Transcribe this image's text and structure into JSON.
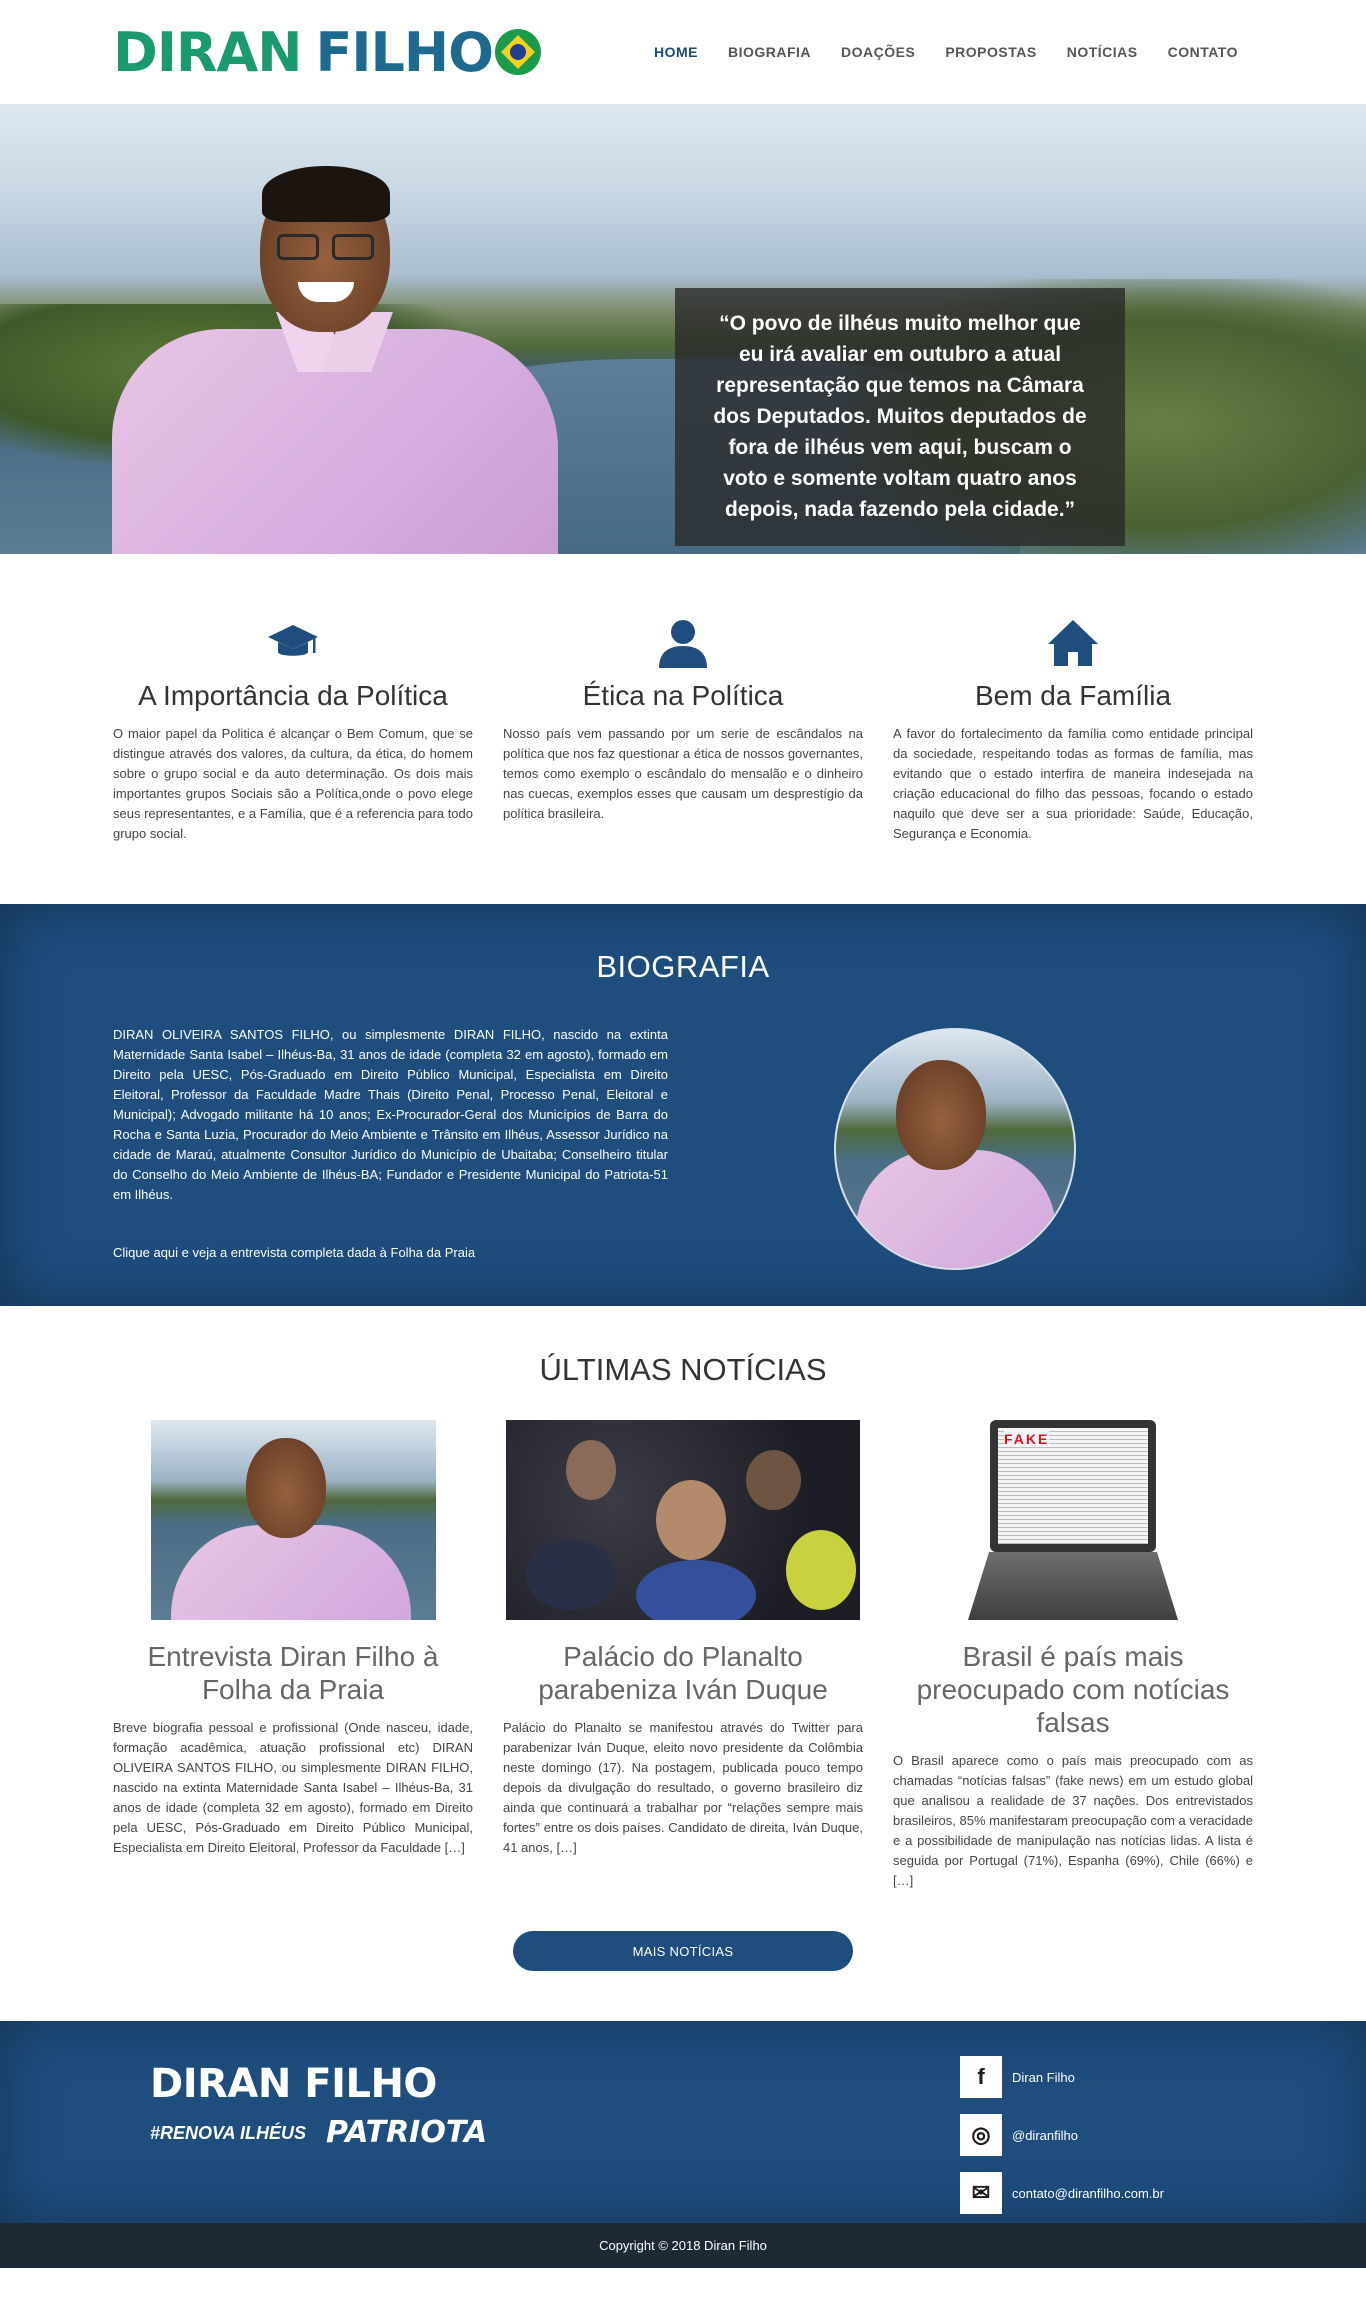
{
  "header": {
    "logo_part1": "DIRAN",
    "logo_part2": "FILHO",
    "nav": [
      {
        "label": "HOME"
      },
      {
        "label": "BIOGRAFIA"
      },
      {
        "label": "DOAÇÕES"
      },
      {
        "label": "PROPOSTAS"
      },
      {
        "label": "NOTÍCIAS"
      },
      {
        "label": "CONTATO"
      }
    ]
  },
  "hero": {
    "quote": "“O povo de ilhéus muito melhor que eu irá avaliar em outubro a atual representação que temos na Câmara dos Deputados. Muitos deputados de fora de ilhéus vem aqui, buscam o voto e somente voltam quatro anos depois, nada fazendo pela cidade.”"
  },
  "features": [
    {
      "icon": "graduation-cap-icon",
      "title": "A Importância da Política",
      "text": "O maior papel da Politica é alcançar o Bem Comum, que se distingue através dos valores, da cultura, da ética, do homem sobre o grupo social e da auto determinação. Os dois mais importantes grupos Sociais são a Política,onde o povo elege seus representantes, e a Família, que é a referencia para todo grupo social."
    },
    {
      "icon": "user-icon",
      "title": "Ética na Política",
      "text": "Nosso país vem passando por um serie de escândalos na política que nos faz questionar a ética de nossos governantes, temos como exemplo o escândalo do mensalão e o dinheiro nas cuecas, exemplos esses que causam um desprestígio da política brasileira."
    },
    {
      "icon": "home-icon",
      "title": "Bem da Família",
      "text": "A favor do fortalecimento da família como entidade principal da sociedade, respeitando todas as formas de família, mas evitando que o estado interfira de maneira indesejada na criação educacional do filho das pessoas, focando o estado naquilo que deve ser a sua prioridade: Saúde, Educação, Segurança e Economia."
    }
  ],
  "bio": {
    "title": "BIOGRAFIA",
    "text": "DIRAN OLIVEIRA SANTOS FILHO, ou simplesmente DIRAN FILHO, nascido na extinta Maternidade Santa Isabel – Ilhéus-Ba, 31 anos de idade (completa 32 em agosto), formado em Direito pela UESC, Pós-Graduado em Direito Público Municipal, Especialista em Direito Eleitoral, Professor da Faculdade Madre Thais (Direito Penal, Processo Penal, Eleitoral e Municipal); Advogado militante há 10 anos; Ex-Procurador-Geral dos Municípios de Barra do Rocha e Santa Luzia, Procurador do Meio Ambiente e Trânsito em Ilhéus, Assessor Jurídico na cidade de Maraú, atualmente Consultor Jurídico do Município de Ubaitaba; Conselheiro titular do Conselho do Meio Ambiente de Ilhéus-BA; Fundador e Presidente Municipal do Patriota-51 em Ilhéus.",
    "link": "Clique aqui e veja a entrevista completa dada à Folha da Praia"
  },
  "news": {
    "title": "ÚLTIMAS NOTÍCIAS",
    "items": [
      {
        "title": "Entrevista Diran Filho à Folha da Praia",
        "excerpt": "Breve biografia pessoal e profissional (Onde nasceu, idade, formação acadêmica, atuação profissional etc) DIRAN OLIVEIRA SANTOS FILHO, ou simplesmente DIRAN FILHO, nascido na extinta Maternidade Santa Isabel – Ilhéus-Ba, 31 anos de idade (completa 32 em agosto), formado em Direito pela UESC, Pós-Graduado em Direito Público Municipal, Especialista em Direito Eleitoral, Professor da Faculdade […]"
      },
      {
        "title": "Palácio do Planalto parabeniza Iván Duque",
        "excerpt": "Palácio do Planalto se manifestou através do Twitter para parabenizar Iván Duque, eleito novo presidente da Colômbia neste domingo (17). Na postagem, publicada pouco tempo depois da divulgação do resultado, o governo brasileiro diz ainda que continuará a trabalhar por “relações sempre mais fortes” entre os dois países. Candidato de direita, Iván Duque, 41 anos, […]"
      },
      {
        "title": "Brasil é país mais preocupado com notícias falsas",
        "excerpt": "O Brasil aparece como o país mais preocupado com as chamadas “notícias falsas” (fake news) em um estudo global que analisou a realidade de 37 nações. Dos entrevistados brasileiros, 85% manifestaram preocupação com a veracidade e a possibilidade de manipulação nas notícias lidas. A lista é seguida por Portugal (71%), Espanha (69%), Chile (66%) e […]",
        "thumb_text": "FAKE"
      }
    ],
    "more_button": "MAIS NOTÍCIAS"
  },
  "footer": {
    "logo": "DIRAN FILHO",
    "tag1": "#RENOVA ILHÉUS",
    "tag2": "PATRIOTA",
    "social": [
      {
        "icon": "facebook-icon",
        "glyph": "f",
        "label": "Diran Filho"
      },
      {
        "icon": "instagram-icon",
        "glyph": "◎",
        "label": "@diranfilho"
      },
      {
        "icon": "mail-icon",
        "glyph": "✉",
        "label": "contato@diranfilho.com.br"
      }
    ],
    "copyright": "Copyright © 2018 Diran Filho"
  }
}
